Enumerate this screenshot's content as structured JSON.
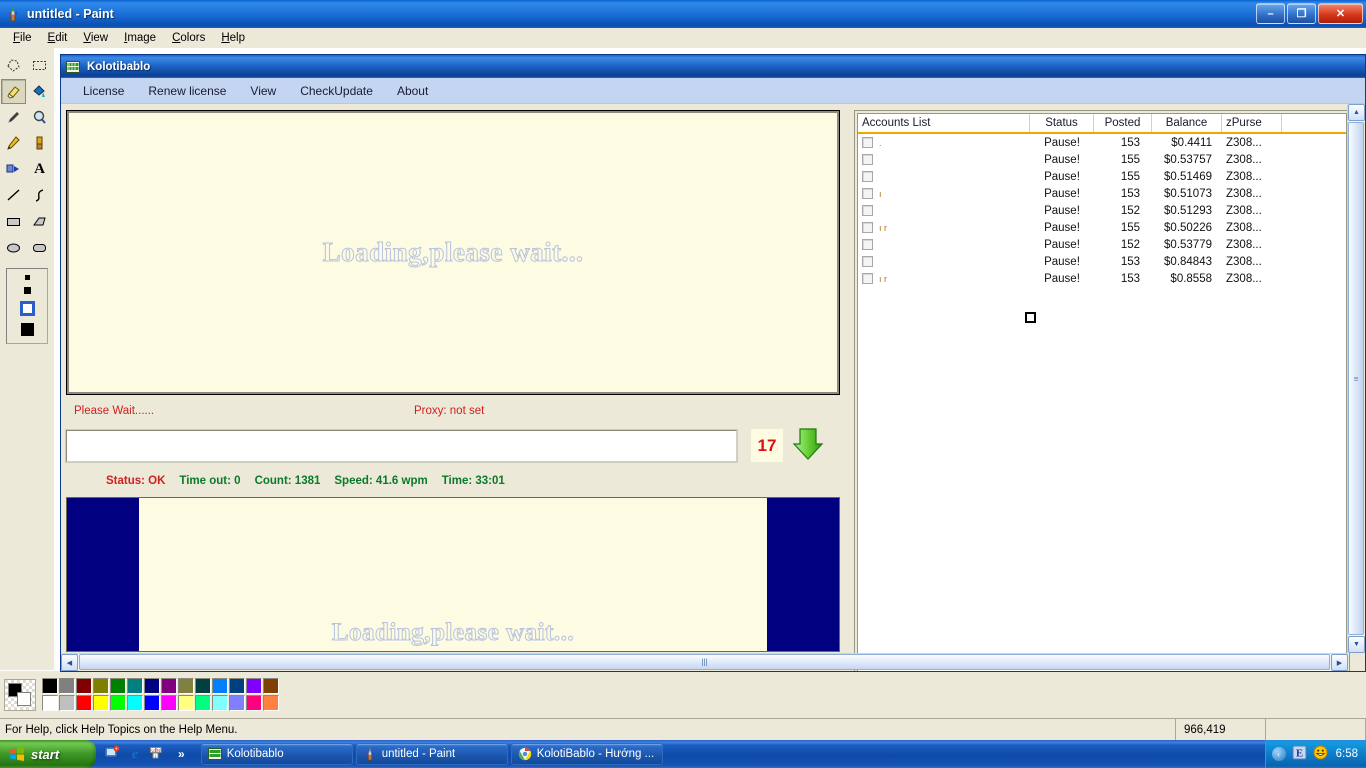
{
  "paint": {
    "title": "untitled - Paint",
    "title_icon": "paint-app-icon",
    "window_buttons": [
      {
        "name": "minimize-button",
        "glyph": "–"
      },
      {
        "name": "maximize-button",
        "glyph": "❐"
      },
      {
        "name": "close-button",
        "glyph": "✕"
      }
    ],
    "menus": [
      {
        "label": "File",
        "accel": "F"
      },
      {
        "label": "Edit",
        "accel": "E"
      },
      {
        "label": "View",
        "accel": "V"
      },
      {
        "label": "Image",
        "accel": "I"
      },
      {
        "label": "Colors",
        "accel": "C"
      },
      {
        "label": "Help",
        "accel": "H"
      }
    ],
    "tools": [
      {
        "name": "free-form-select-tool",
        "glyph": "✧"
      },
      {
        "name": "rectangle-select-tool",
        "glyph": "⬚"
      },
      {
        "name": "eraser-tool",
        "glyph": "▱",
        "active": true
      },
      {
        "name": "fill-with-color-tool",
        "glyph": "🪣"
      },
      {
        "name": "pick-color-tool",
        "glyph": "⚲"
      },
      {
        "name": "magnifier-tool",
        "glyph": "🔍"
      },
      {
        "name": "pencil-tool",
        "glyph": "✏"
      },
      {
        "name": "brush-tool",
        "glyph": "🖌"
      },
      {
        "name": "airbrush-tool",
        "glyph": "❖"
      },
      {
        "name": "text-tool",
        "glyph": "A"
      },
      {
        "name": "line-tool",
        "glyph": "╲"
      },
      {
        "name": "curve-tool",
        "glyph": "∫"
      },
      {
        "name": "rectangle-tool",
        "glyph": "▭"
      },
      {
        "name": "polygon-tool",
        "glyph": "◿"
      },
      {
        "name": "ellipse-tool",
        "glyph": "⬭"
      },
      {
        "name": "rounded-rectangle-tool",
        "glyph": "▢"
      }
    ],
    "tool_option_sizes": [
      "4",
      "6",
      "selected",
      "10"
    ],
    "palette_row1": [
      "#000000",
      "#808080",
      "#800000",
      "#808000",
      "#008000",
      "#008080",
      "#000080",
      "#800080",
      "#808040",
      "#004040",
      "#0080ff",
      "#004080",
      "#8000ff",
      "#804000"
    ],
    "palette_row2": [
      "#ffffff",
      "#c0c0c0",
      "#ff0000",
      "#ffff00",
      "#00ff00",
      "#00ffff",
      "#0000ff",
      "#ff00ff",
      "#ffff80",
      "#00ff80",
      "#80ffff",
      "#8080ff",
      "#ff0080",
      "#ff8040"
    ],
    "foreground_color": "#000000",
    "background_color": "#ffffff",
    "statusbar": {
      "help_text": "For Help, click Help Topics on the Help Menu.",
      "size_text": "966,419"
    }
  },
  "kolotibablo": {
    "title": "Kolotibablo",
    "title_icon": "kolotibablo-app-icon",
    "menus": [
      {
        "label": "License"
      },
      {
        "label": "Renew license"
      },
      {
        "label": "View"
      },
      {
        "label": "CheckUpdate"
      },
      {
        "label": "About"
      }
    ],
    "captcha": {
      "loading_text": "Loading,please wait...",
      "please_wait": "Please Wait......",
      "proxy": "Proxy: not set",
      "answer_value": "",
      "answer_placeholder": "",
      "counter": "17",
      "arrow_icon": "down-arrow-icon",
      "counter_color": "#e01010"
    },
    "metrics": {
      "status": "Status: OK",
      "timeout": "Time out: 0",
      "count": "Count: 1381",
      "speed": "Speed: 41.6 wpm",
      "time": "Time: 33:01",
      "status_color": "#d02020",
      "metric_color": "#0a7a2a"
    },
    "banner": {
      "loading_text": "Loading,please wait...",
      "side_color": "#000080"
    },
    "accounts": {
      "header_accent": "#f0a800",
      "columns": [
        {
          "key": "name",
          "label": "Accounts List"
        },
        {
          "key": "status",
          "label": "Status"
        },
        {
          "key": "posted",
          "label": "Posted"
        },
        {
          "key": "balance",
          "label": "Balance"
        },
        {
          "key": "purse",
          "label": "zPurse"
        }
      ],
      "rows": [
        {
          "mark": ".",
          "status": "Pause!",
          "posted": "153",
          "balance": "$0.4411",
          "purse": "Z308..."
        },
        {
          "mark": "",
          "status": "Pause!",
          "posted": "155",
          "balance": "$0.53757",
          "purse": "Z308..."
        },
        {
          "mark": "",
          "status": "Pause!",
          "posted": "155",
          "balance": "$0.51469",
          "purse": "Z308..."
        },
        {
          "mark": "ı",
          "status": "Pause!",
          "posted": "153",
          "balance": "$0.51073",
          "purse": "Z308..."
        },
        {
          "mark": "",
          "status": "Pause!",
          "posted": "152",
          "balance": "$0.51293",
          "purse": "Z308..."
        },
        {
          "mark": "ı r",
          "status": "Pause!",
          "posted": "155",
          "balance": "$0.50226",
          "purse": "Z308..."
        },
        {
          "mark": "",
          "status": "Pause!",
          "posted": "152",
          "balance": "$0.53779",
          "purse": "Z308..."
        },
        {
          "mark": "",
          "status": "Pause!",
          "posted": "153",
          "balance": "$0.84843",
          "purse": "Z308..."
        },
        {
          "mark": "ı r",
          "status": "Pause!",
          "posted": "153",
          "balance": "$0.8558",
          "purse": "Z308..."
        }
      ]
    }
  },
  "taskbar": {
    "start_label": "start",
    "quicklaunch": [
      {
        "name": "show-desktop-icon",
        "glyph": "▣"
      },
      {
        "name": "internet-explorer-icon",
        "glyph": "e"
      },
      {
        "name": "unikey-icon",
        "glyph": "UN"
      }
    ],
    "overflow_glyph": "»",
    "tasks": [
      {
        "label": "Kolotibablo",
        "icon": "kolotibablo-app-icon"
      },
      {
        "label": "untitled - Paint",
        "icon": "paint-app-icon"
      },
      {
        "label": "KolotiBablo - Hướng ...",
        "icon": "chrome-icon"
      }
    ],
    "tray": [
      {
        "name": "tray-expand-icon",
        "glyph": "‹"
      },
      {
        "name": "unikey-tray-icon",
        "glyph": "E"
      },
      {
        "name": "smiley-tray-icon",
        "glyph": "😀"
      }
    ],
    "clock": "6:58"
  }
}
